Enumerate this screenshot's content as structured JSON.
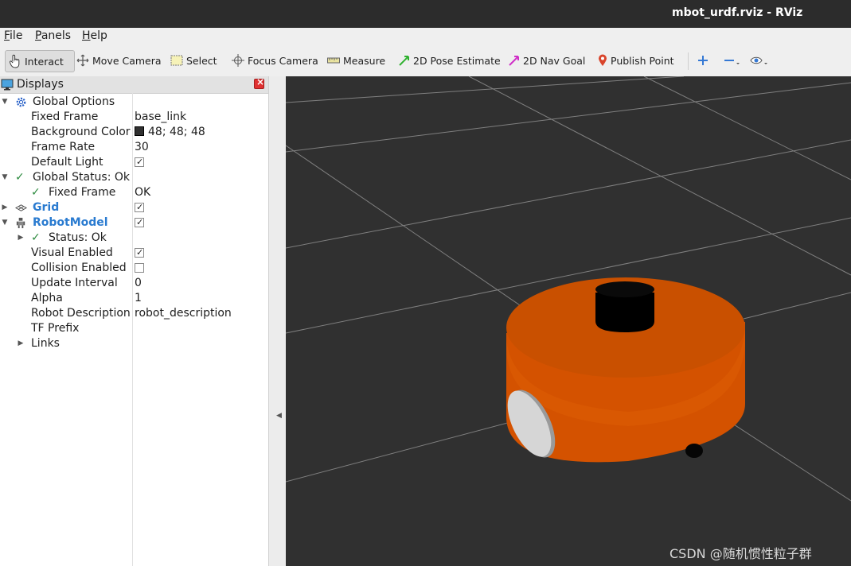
{
  "window": {
    "title": "mbot_urdf.rviz - RViz"
  },
  "menu": [
    {
      "label": "File",
      "accel": "F",
      "rest": "ile"
    },
    {
      "label": "Panels",
      "accel": "P",
      "rest": "anels"
    },
    {
      "label": "Help",
      "accel": "H",
      "rest": "elp"
    }
  ],
  "toolbar": {
    "interact": "Interact",
    "move_camera": "Move Camera",
    "select": "Select",
    "focus_camera": "Focus Camera",
    "measure": "Measure",
    "pose_estimate": "2D Pose Estimate",
    "nav_goal": "2D Nav Goal",
    "publish_point": "Publish Point"
  },
  "displays": {
    "title": "Displays",
    "global_options": "Global Options",
    "fixed_frame_label": "Fixed Frame",
    "fixed_frame_value": "base_link",
    "background_color_label": "Background Color",
    "background_color_value": "48; 48; 48",
    "background_color_hex": "#303030",
    "frame_rate_label": "Frame Rate",
    "frame_rate_value": "30",
    "default_light_label": "Default Light",
    "default_light_checked": true,
    "global_status": "Global Status: Ok",
    "status_fixed_frame_label": "Fixed Frame",
    "status_fixed_frame_value": "OK",
    "grid_label": "Grid",
    "grid_checked": true,
    "robot_model_label": "RobotModel",
    "robot_model_checked": true,
    "status_ok": "Status: Ok",
    "visual_enabled_label": "Visual Enabled",
    "visual_enabled_checked": true,
    "collision_enabled_label": "Collision Enabled",
    "collision_enabled_checked": false,
    "update_interval_label": "Update Interval",
    "update_interval_value": "0",
    "alpha_label": "Alpha",
    "alpha_value": "1",
    "robot_description_label": "Robot Description",
    "robot_description_value": "robot_description",
    "tf_prefix_label": "TF Prefix",
    "links_label": "Links"
  },
  "viewport": {
    "background": "#303030",
    "robot_body_color": "#e65c00"
  },
  "watermark": "CSDN @随机惯性粒子群"
}
